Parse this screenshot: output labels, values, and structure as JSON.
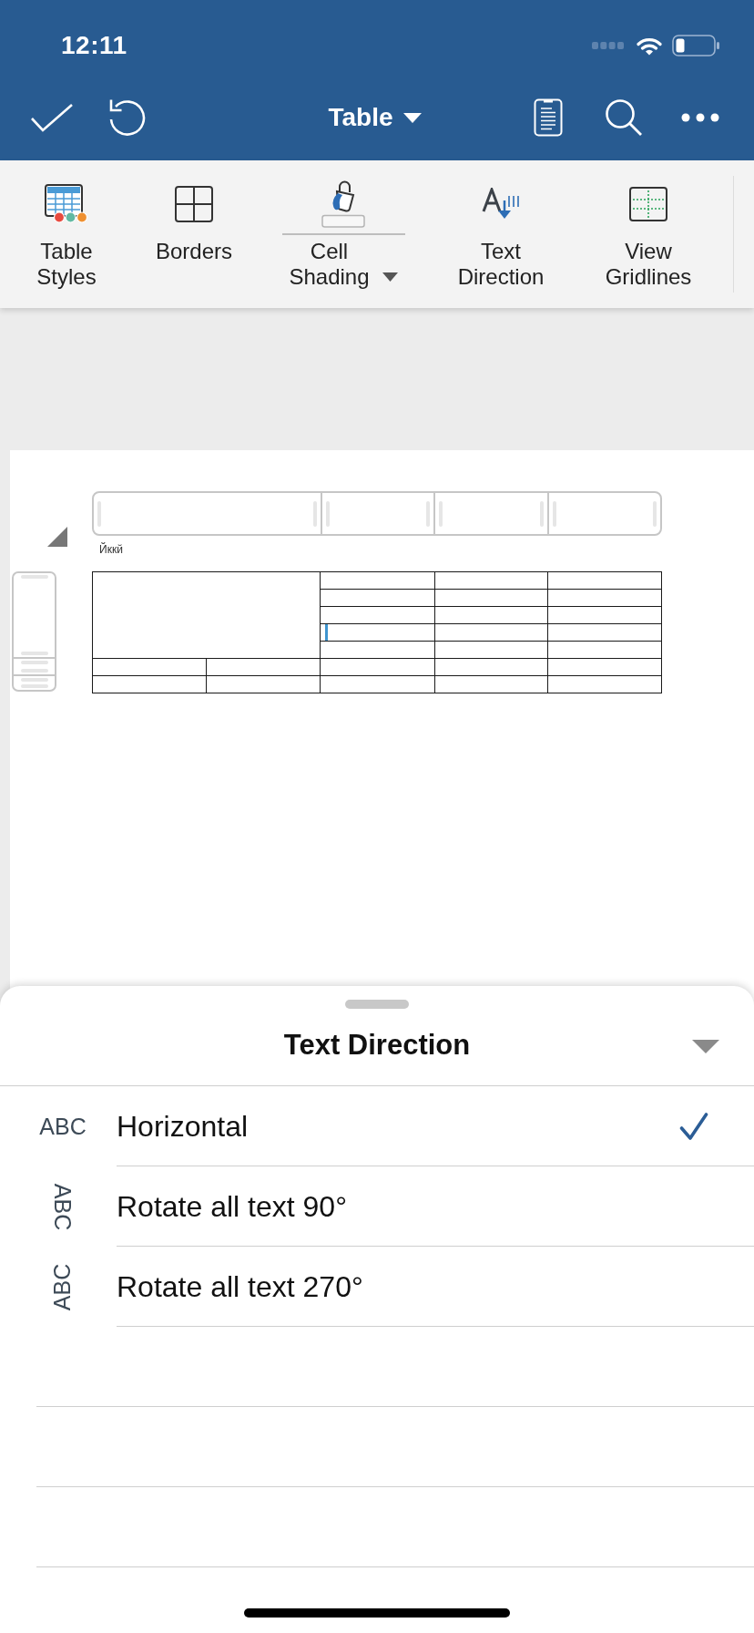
{
  "status_bar": {
    "time": "12:11"
  },
  "toolbar": {
    "title": "Table"
  },
  "ribbon": {
    "items": [
      {
        "kind": "button",
        "label": "Table Styles"
      },
      {
        "kind": "button",
        "label": "Borders"
      },
      {
        "kind": "split",
        "label": "Cell Shading"
      },
      {
        "kind": "button",
        "label": "Text Direction"
      },
      {
        "kind": "button",
        "label": "View Gridlines"
      }
    ]
  },
  "document": {
    "table_label": "Йккй",
    "table": {
      "cursor": true
    }
  },
  "sheet": {
    "title": "Text Direction",
    "options": [
      {
        "kind": "horizontal",
        "sample": "ABC",
        "label": "Horizontal",
        "selected": true
      },
      {
        "kind": "rotate90",
        "sample": "ABC",
        "label": "Rotate all text 90°",
        "selected": false
      },
      {
        "kind": "rotate270",
        "sample": "ABC",
        "label": "Rotate all text 270°",
        "selected": false
      }
    ]
  }
}
